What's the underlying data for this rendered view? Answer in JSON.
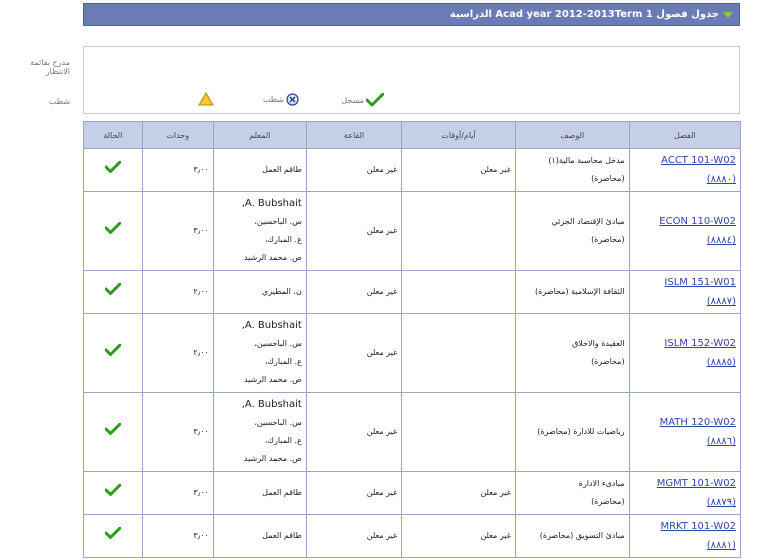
{
  "header": {
    "title": "جدول فصول Acad year 2012-2013Term 1 الدراسية"
  },
  "side": {
    "waitlist_label": "مدرج بقائمة الانتظار",
    "dropped_label": "شطب"
  },
  "legend": {
    "enrolled": "مسجل",
    "dropped": "شطب"
  },
  "columns": [
    "الفصل",
    "الوصف",
    "أيام/أوقات",
    "القاعة",
    "المعلم",
    "وحدات",
    "الحالة"
  ],
  "rows": [
    {
      "class_code": "ACCT 101-W02",
      "class_number": "(٨٨٨٠)",
      "desc": [
        "مدخل محاسبة مالية(١)",
        "(محاضرة)"
      ],
      "days": "غير معلن",
      "room": "غير معلن",
      "instructor": [
        "طاقم العمل"
      ],
      "units": "٣٫٠٠"
    },
    {
      "class_code": "ECON 110-W02",
      "class_number": "(٨٨٨٤)",
      "desc": [
        "مبادئ الإقتصاد الجزئي",
        "(محاضرة)"
      ],
      "days": "",
      "room": "غير معلن",
      "instructor": [
        "A. Bubshait,",
        "س. الباحسين،",
        "ع. المبارك،",
        "ص. محمد الرشيد"
      ],
      "units": "٣٫٠٠"
    },
    {
      "class_code": "ISLM 151-W01",
      "class_number": "(٨٨٨٧)",
      "desc": [
        "الثقافة الإسلامية (محاضرة)"
      ],
      "days": "",
      "room": "غير معلن",
      "instructor": [
        "ن. المطيري"
      ],
      "units": "٢٫٠٠"
    },
    {
      "class_code": "ISLM 152-W02",
      "class_number": "(٨٨٨٥)",
      "desc": [
        "العقيدة والاخلاق",
        "(محاضرة)"
      ],
      "days": "",
      "room": "غير معلن",
      "instructor": [
        "A. Bubshait,",
        "س. الباحسين،",
        "ع. المبارك،",
        "ص. محمد الرشيد"
      ],
      "units": "٢٫٠٠"
    },
    {
      "class_code": "MATH 120-W02",
      "class_number": "(٨٨٨٦)",
      "desc": [
        "رياضيات للادارة (محاضرة)"
      ],
      "days": "",
      "room": "غير معلن",
      "instructor": [
        "A. Bubshait,",
        "س. الباحسين،",
        "ع. المبارك،",
        "ص. محمد الرشيد"
      ],
      "units": "٣٫٠٠"
    },
    {
      "class_code": "MGMT 101-W02",
      "class_number": "(٨٨٧٩)",
      "desc": [
        "مبادىء الادارة",
        "(محاضرة)"
      ],
      "days": "غير معلن",
      "room": "غير معلن",
      "instructor": [
        "طاقم العمل"
      ],
      "units": "٣٫٠٠"
    },
    {
      "class_code": "MRKT 101-W02",
      "class_number": "(٨٨٨١)",
      "desc": [
        "مبادئ التسويق (محاضرة)"
      ],
      "days": "غير معلن",
      "room": "غير معلن",
      "instructor": [
        "طاقم العمل"
      ],
      "units": "٣٫٠٠"
    }
  ],
  "icons": {
    "status": "check-icon",
    "enrolled": "check-icon",
    "dropped": "x-circle-icon",
    "waitlist": "warning-triangle-icon"
  },
  "colors": {
    "header_bg": "#6a7bb6",
    "table_header_bg": "#c5d0e8",
    "link": "#3344aa",
    "check": "#2e9b1f"
  }
}
